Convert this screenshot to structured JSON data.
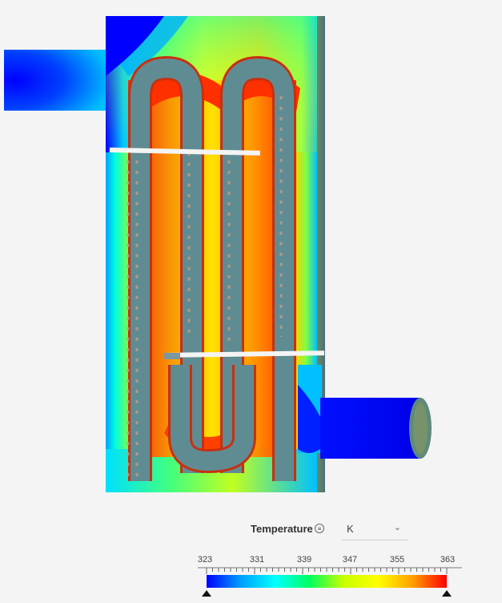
{
  "legend": {
    "title": "Temperature",
    "info_icon": "≡",
    "unit": "K",
    "unit_icon": "chevron-down-icon",
    "min": 323,
    "max": 363,
    "ticks": [
      "323",
      "331",
      "339",
      "347",
      "355",
      "363"
    ],
    "colormap": [
      "#0000ff",
      "#00a0ff",
      "#00ffff",
      "#00ff60",
      "#c8ff00",
      "#ffff00",
      "#ffa000",
      "#ff0000"
    ]
  }
}
